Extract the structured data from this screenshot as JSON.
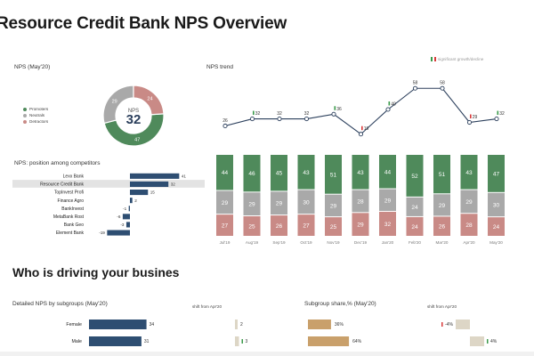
{
  "page_title": "Resource Credit Bank NPS Overview",
  "section_title": "Who is driving your busines",
  "colors": {
    "promoters": "#4f8a5b",
    "neutrals": "#a9a9a9",
    "detractors": "#c98a86",
    "bar_blue": "#2e4e72",
    "bar_gold": "#c9a06b",
    "line": "#2b3f5c"
  },
  "legend_note": "significant growth/decline",
  "chart_data": [
    {
      "type": "pie",
      "title": "NPS (May'20)",
      "center_label": "NPS",
      "center_value": "32",
      "categories": [
        "Promoters",
        "Neutrals",
        "Detractors"
      ],
      "values": [
        47,
        29,
        24
      ]
    },
    {
      "type": "line",
      "title": "NPS trend",
      "x": [
        "Jul'19",
        "Aug'19",
        "Sep'19",
        "Oct'19",
        "Nov'19",
        "Dec'19",
        "Jan'20",
        "Feb'20",
        "Mar'20",
        "Apr'20",
        "May'20"
      ],
      "values": [
        26,
        32,
        32,
        32,
        36,
        19,
        40,
        58,
        58,
        29,
        32
      ],
      "markers": [
        "",
        "up",
        "",
        "",
        "up",
        "down",
        "up",
        "",
        "",
        "down",
        "up"
      ]
    },
    {
      "type": "bar",
      "stacked": true,
      "categories": [
        "Jul'19",
        "Aug'19",
        "Sep'19",
        "Oct'19",
        "Nov'19",
        "Dec'19",
        "Jan'20",
        "Feb'20",
        "Mar'20",
        "Apr'20",
        "May'20"
      ],
      "series": [
        {
          "name": "Promoters",
          "values": [
            44,
            46,
            45,
            43,
            51,
            43,
            44,
            52,
            51,
            43,
            47
          ]
        },
        {
          "name": "Neutrals",
          "values": [
            29,
            29,
            29,
            30,
            29,
            28,
            29,
            24,
            29,
            29,
            30
          ]
        },
        {
          "name": "Detractors",
          "values": [
            27,
            25,
            26,
            27,
            25,
            29,
            32,
            24,
            26,
            28,
            24
          ]
        }
      ]
    },
    {
      "type": "bar",
      "orientation": "horizontal",
      "title": "NPS: position among competitors",
      "categories": [
        "Lexx Bank",
        "Resource Credit Bank",
        "TopInvest Profi",
        "Finance Agro",
        "BankInvest",
        "MetaBank Rost",
        "Bank Geo",
        "Element Bank"
      ],
      "values": [
        41,
        32,
        15,
        2,
        -1,
        -6,
        -3,
        -19
      ],
      "highlight": "Resource Credit Bank"
    },
    {
      "type": "bar",
      "orientation": "horizontal",
      "title": "Detailed NPS by subgroups (May'20)",
      "shift_label": "shift from Apr'20",
      "categories": [
        "Female",
        "Male"
      ],
      "values": [
        34,
        31
      ],
      "shift": [
        2,
        3
      ],
      "shift_markers": [
        "",
        "up"
      ]
    },
    {
      "type": "bar",
      "orientation": "horizontal",
      "title": "Subgroup share,% (May'20)",
      "shift_label": "shift from Apr'20",
      "categories": [
        "Female",
        "Male"
      ],
      "values": [
        "36%",
        "64%"
      ],
      "shift": [
        "-4%",
        "4%"
      ],
      "shift_markers": [
        "down",
        "up"
      ]
    }
  ]
}
